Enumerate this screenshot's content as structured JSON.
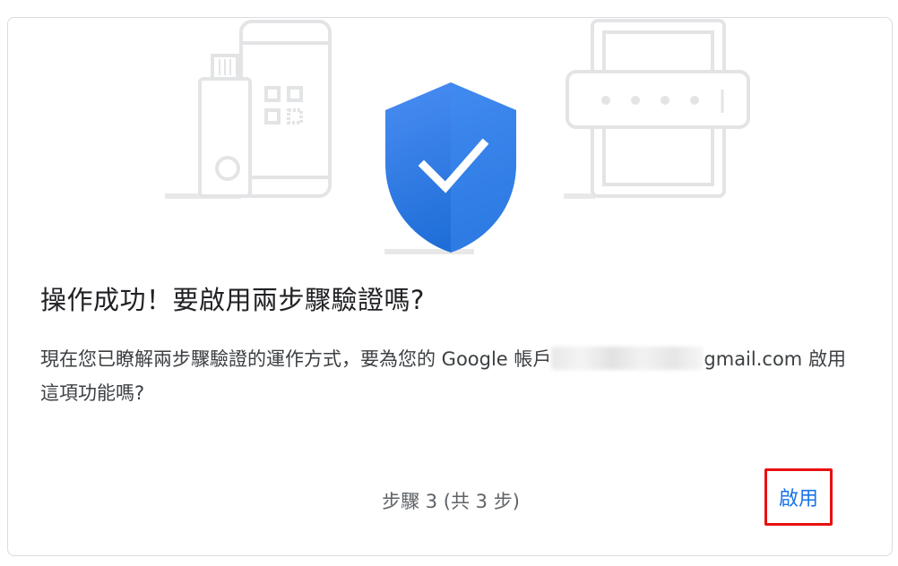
{
  "dialog": {
    "title": "操作成功！要啟用兩步驟驗證嗎?",
    "description_prefix": "現在您已瞭解兩步驟驗證的運作方式，要為您的 Google 帳戶",
    "email_suffix": "gmail.com",
    "description_suffix": " 啟用這項功能嗎?",
    "step_text": "步驟 3 (共 3 步)",
    "enable_label": "啟用"
  },
  "icons": {
    "left": "security-key-and-phone-qr-icon",
    "center": "shield-check-icon",
    "right": "password-field-icon"
  },
  "colors": {
    "accent": "#1a73e8",
    "shield": "#2f7de1",
    "highlight_border": "#e8100f"
  }
}
